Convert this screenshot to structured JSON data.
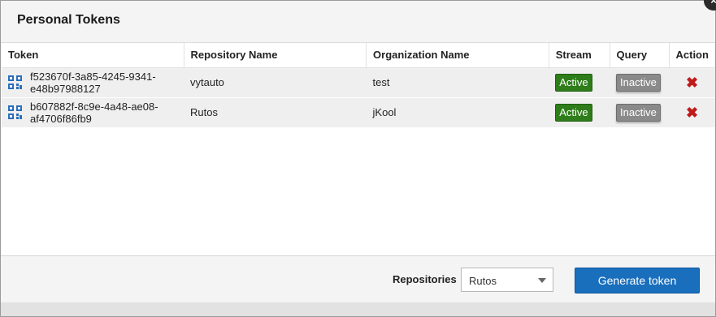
{
  "dialog": {
    "title": "Personal Tokens",
    "close_glyph": "×"
  },
  "table": {
    "headers": {
      "token": "Token",
      "repository": "Repository Name",
      "organization": "Organization Name",
      "stream": "Stream",
      "query": "Query",
      "action": "Action"
    },
    "rows": [
      {
        "token_line1": "f523670f-3a85-4245-9341-",
        "token_line2": "e48b97988127",
        "repository": "vytauto",
        "organization": "test",
        "stream": "Active",
        "query": "Inactive",
        "action_icon": "delete-icon"
      },
      {
        "token_line1": "b607882f-8c9e-4a48-ae08-",
        "token_line2": "af4706f86fb9",
        "repository": "Rutos",
        "organization": "jKool",
        "stream": "Active",
        "query": "Inactive",
        "action_icon": "delete-icon"
      }
    ]
  },
  "footer": {
    "repositories_label": "Repositories",
    "repositories_selected": "Rutos",
    "generate_button": "Generate token"
  },
  "colors": {
    "active_badge": "#2e7d1a",
    "inactive_badge": "#8a8a8a",
    "primary_button": "#1a6fbd",
    "delete_icon": "#c01a1a"
  }
}
